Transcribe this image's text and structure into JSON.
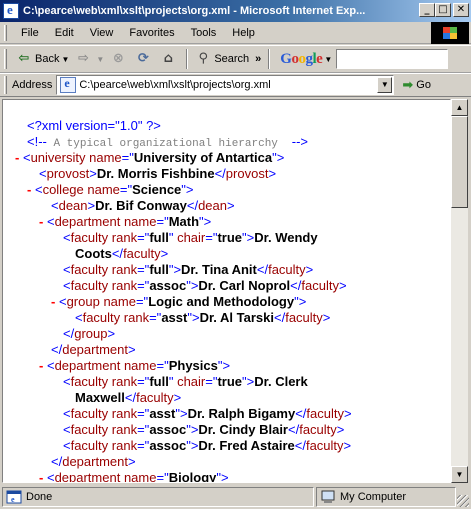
{
  "window": {
    "title": "C:\\pearce\\web\\xml\\xslt\\projects\\org.xml - Microsoft Internet Exp...",
    "min_glyph": "_",
    "max_glyph": "□",
    "close_glyph": "✕"
  },
  "menu": [
    "File",
    "Edit",
    "View",
    "Favorites",
    "Tools",
    "Help"
  ],
  "toolbar": {
    "back_label": "Back",
    "search_label": "Search",
    "more_glyph": "»",
    "google_logo": "Google"
  },
  "address": {
    "label": "Address",
    "url": "C:\\pearce\\web\\xml\\xslt\\projects\\org.xml",
    "go_label": "Go"
  },
  "xml": {
    "pi": "<?xml version=\"1.0\" ?>",
    "comment_open": "<!--",
    "comment_text": " A typical organizational hierarchy ",
    "comment_close": "-->",
    "university": {
      "tag": "university",
      "attr": "name",
      "value": "University of Antartica"
    },
    "provost": {
      "tag": "provost",
      "text": "Dr. Morris Fishbine"
    },
    "college": {
      "tag": "college",
      "attr": "name",
      "value": "Science"
    },
    "dean": {
      "tag": "dean",
      "text": "Dr. Bif Conway"
    },
    "dept_math": {
      "tag": "department",
      "attr": "name",
      "value": "Math"
    },
    "fac1": {
      "tag": "faculty",
      "attr1": "rank",
      "val1": "full",
      "attr2": "chair",
      "val2": "true",
      "text1": "Dr. Wendy",
      "text2": "Coots"
    },
    "fac2": {
      "tag": "faculty",
      "attr1": "rank",
      "val1": "full",
      "text": "Dr. Tina Anit"
    },
    "fac3": {
      "tag": "faculty",
      "attr1": "rank",
      "val1": "assoc",
      "text": "Dr. Carl Noprol"
    },
    "group": {
      "tag": "group",
      "attr": "name",
      "value": "Logic and Methodology"
    },
    "fac4": {
      "tag": "faculty",
      "attr1": "rank",
      "val1": "asst",
      "text": "Dr. Al Tarski"
    },
    "group_close": "group",
    "dept_close": "department",
    "dept_physics": {
      "tag": "department",
      "attr": "name",
      "value": "Physics"
    },
    "fac5": {
      "tag": "faculty",
      "attr1": "rank",
      "val1": "full",
      "attr2": "chair",
      "val2": "true",
      "text1": "Dr. Clerk",
      "text2": "Maxwell"
    },
    "fac6": {
      "tag": "faculty",
      "attr1": "rank",
      "val1": "asst",
      "text": "Dr. Ralph Bigamy"
    },
    "fac7": {
      "tag": "faculty",
      "attr1": "rank",
      "val1": "assoc",
      "text": "Dr. Cindy Blair"
    },
    "fac8": {
      "tag": "faculty",
      "attr1": "rank",
      "val1": "assoc",
      "text": "Dr. Fred Astaire"
    },
    "dept_biology": {
      "tag": "department",
      "attr": "name",
      "value": "Biology"
    },
    "minus": "-"
  },
  "status": {
    "text": "Done",
    "zone": "My Computer"
  }
}
